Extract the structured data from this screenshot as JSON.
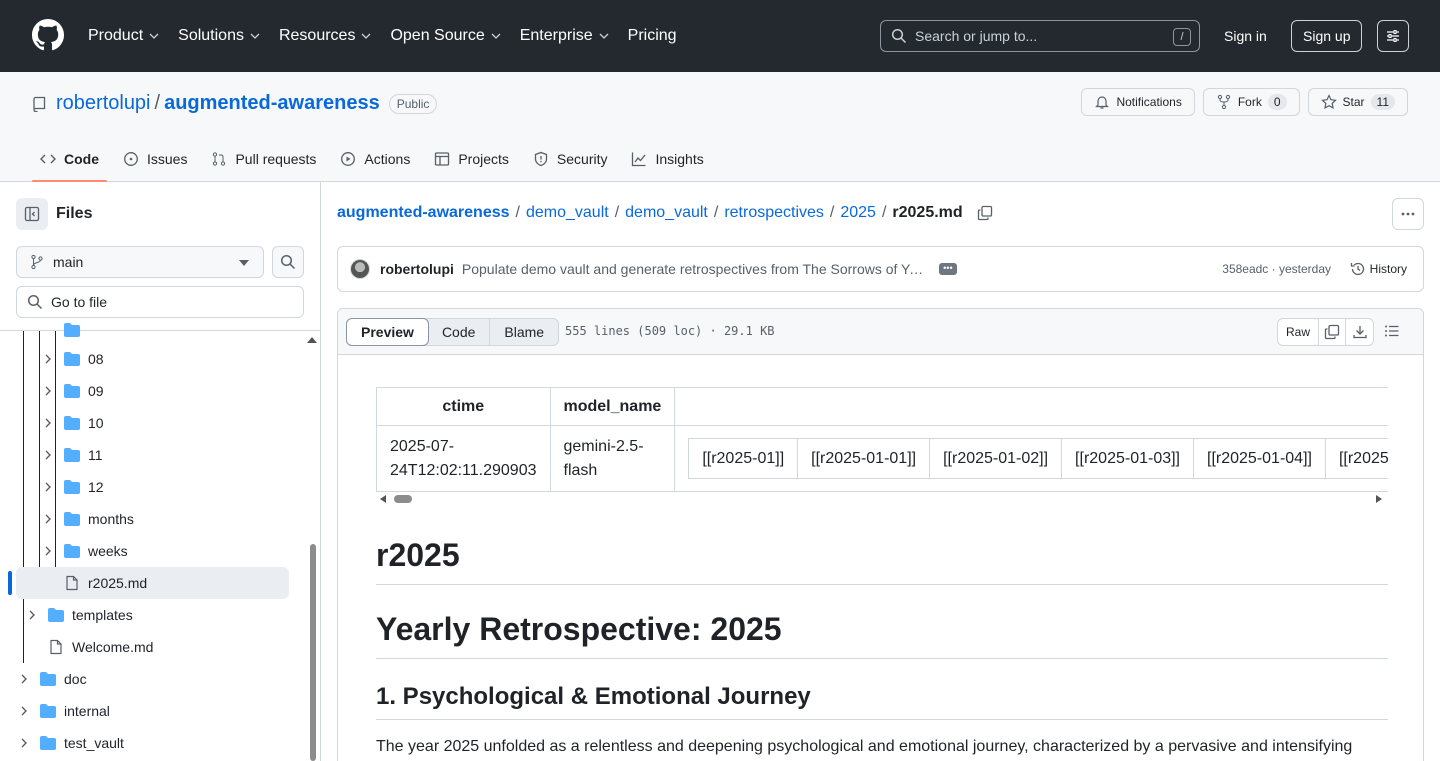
{
  "header": {
    "nav": [
      "Product",
      "Solutions",
      "Resources",
      "Open Source",
      "Enterprise",
      "Pricing"
    ],
    "search_placeholder": "Search or jump to...",
    "search_shortcut": "/",
    "signin": "Sign in",
    "signup": "Sign up"
  },
  "repo": {
    "owner": "robertolupi",
    "name": "augmented-awareness",
    "visibility": "Public",
    "notifications": "Notifications",
    "fork_label": "Fork",
    "fork_count": "0",
    "star_label": "Star",
    "star_count": "11"
  },
  "tabs": [
    "Code",
    "Issues",
    "Pull requests",
    "Actions",
    "Projects",
    "Security",
    "Insights"
  ],
  "sidebar": {
    "title": "Files",
    "branch": "main",
    "goto_placeholder": "Go to file",
    "tree": [
      {
        "label": "08",
        "type": "folder"
      },
      {
        "label": "09",
        "type": "folder"
      },
      {
        "label": "10",
        "type": "folder"
      },
      {
        "label": "11",
        "type": "folder"
      },
      {
        "label": "12",
        "type": "folder"
      },
      {
        "label": "months",
        "type": "folder"
      },
      {
        "label": "weeks",
        "type": "folder"
      },
      {
        "label": "r2025.md",
        "type": "file"
      },
      {
        "label": "templates",
        "type": "folder"
      },
      {
        "label": "Welcome.md",
        "type": "file"
      },
      {
        "label": "doc",
        "type": "folder"
      },
      {
        "label": "internal",
        "type": "folder"
      },
      {
        "label": "test_vault",
        "type": "folder"
      }
    ]
  },
  "breadcrumb": {
    "parts": [
      "augmented-awareness",
      "demo_vault",
      "demo_vault",
      "retrospectives",
      "2025"
    ],
    "current": "r2025.md"
  },
  "commit": {
    "author": "robertolupi",
    "message": "Populate demo vault and generate retrospectives from The Sorrows of Young Werther",
    "sha_time": "358eadc · yesterday",
    "history": "History"
  },
  "file": {
    "view_preview": "Preview",
    "view_code": "Code",
    "view_blame": "Blame",
    "info": "555 lines (509 loc) · 29.1 KB",
    "raw": "Raw"
  },
  "meta_table": {
    "headers": [
      "ctime",
      "model_name",
      ""
    ],
    "ctime": "2025-07-24T12:02:11.290903",
    "ctime_a": "2025-07-",
    "ctime_b": "24T12:02:11.290903",
    "model_a": "gemini-2.5-",
    "model_b": "flash",
    "links": [
      "[[r2025-01]]",
      "[[r2025-01-01]]",
      "[[r2025-01-02]]",
      "[[r2025-01-03]]",
      "[[r2025-01-04]]",
      "[[r2025"
    ]
  },
  "doc": {
    "h1": "r2025",
    "h1b": "Yearly Retrospective: 2025",
    "h2": "1. Psychological & Emotional Journey",
    "para": "The year 2025 unfolded as a relentless and deepening psychological and emotional journey, characterized by a pervasive and intensifying"
  }
}
